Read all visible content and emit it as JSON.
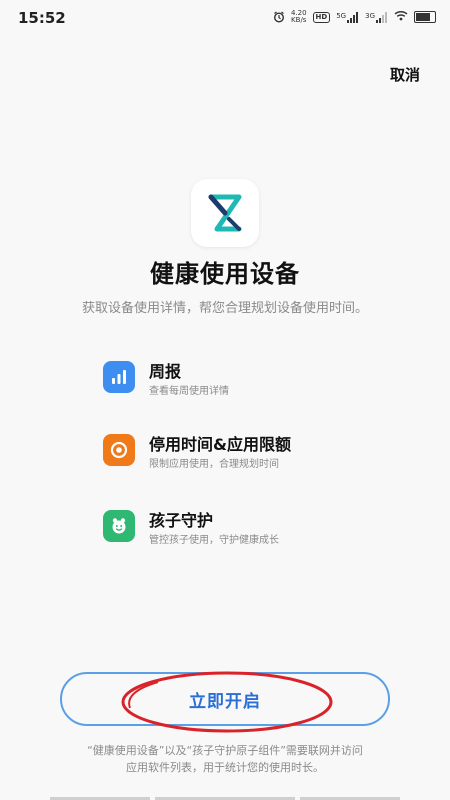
{
  "status_bar": {
    "time": "15:52",
    "net_speed_value": "4.20",
    "net_speed_unit": "KB/s",
    "hd_label": "HD",
    "signal1_label": "5G",
    "signal2_label": "3G"
  },
  "header": {
    "cancel_label": "取消"
  },
  "app": {
    "title": "健康使用设备",
    "subtitle": "获取设备使用详情，帮您合理规划设备使用时间。"
  },
  "features": [
    {
      "title": "周报",
      "desc": "查看每周使用详情",
      "icon": "bar-chart-icon",
      "color": "#3d8ef0"
    },
    {
      "title": "停用时间&应用限额",
      "desc": "限制应用使用，合理规划时间",
      "icon": "timer-icon",
      "color": "#f07a1a"
    },
    {
      "title": "孩子守护",
      "desc": "管控孩子使用，守护健康成长",
      "icon": "child-face-icon",
      "color": "#2fb872"
    }
  ],
  "action": {
    "start_label": "立即开启"
  },
  "footnote": {
    "line1": "“健康使用设备”以及“孩子守护原子组件”需要联网并访问",
    "line2": "应用软件列表，用于统计您的使用时长。"
  },
  "colors": {
    "accent": "#2b6fd6",
    "button_border": "#5aa0e6",
    "annotation": "#d9232a",
    "logo_teal": "#1fb8b5",
    "logo_navy": "#1d3b6b"
  }
}
